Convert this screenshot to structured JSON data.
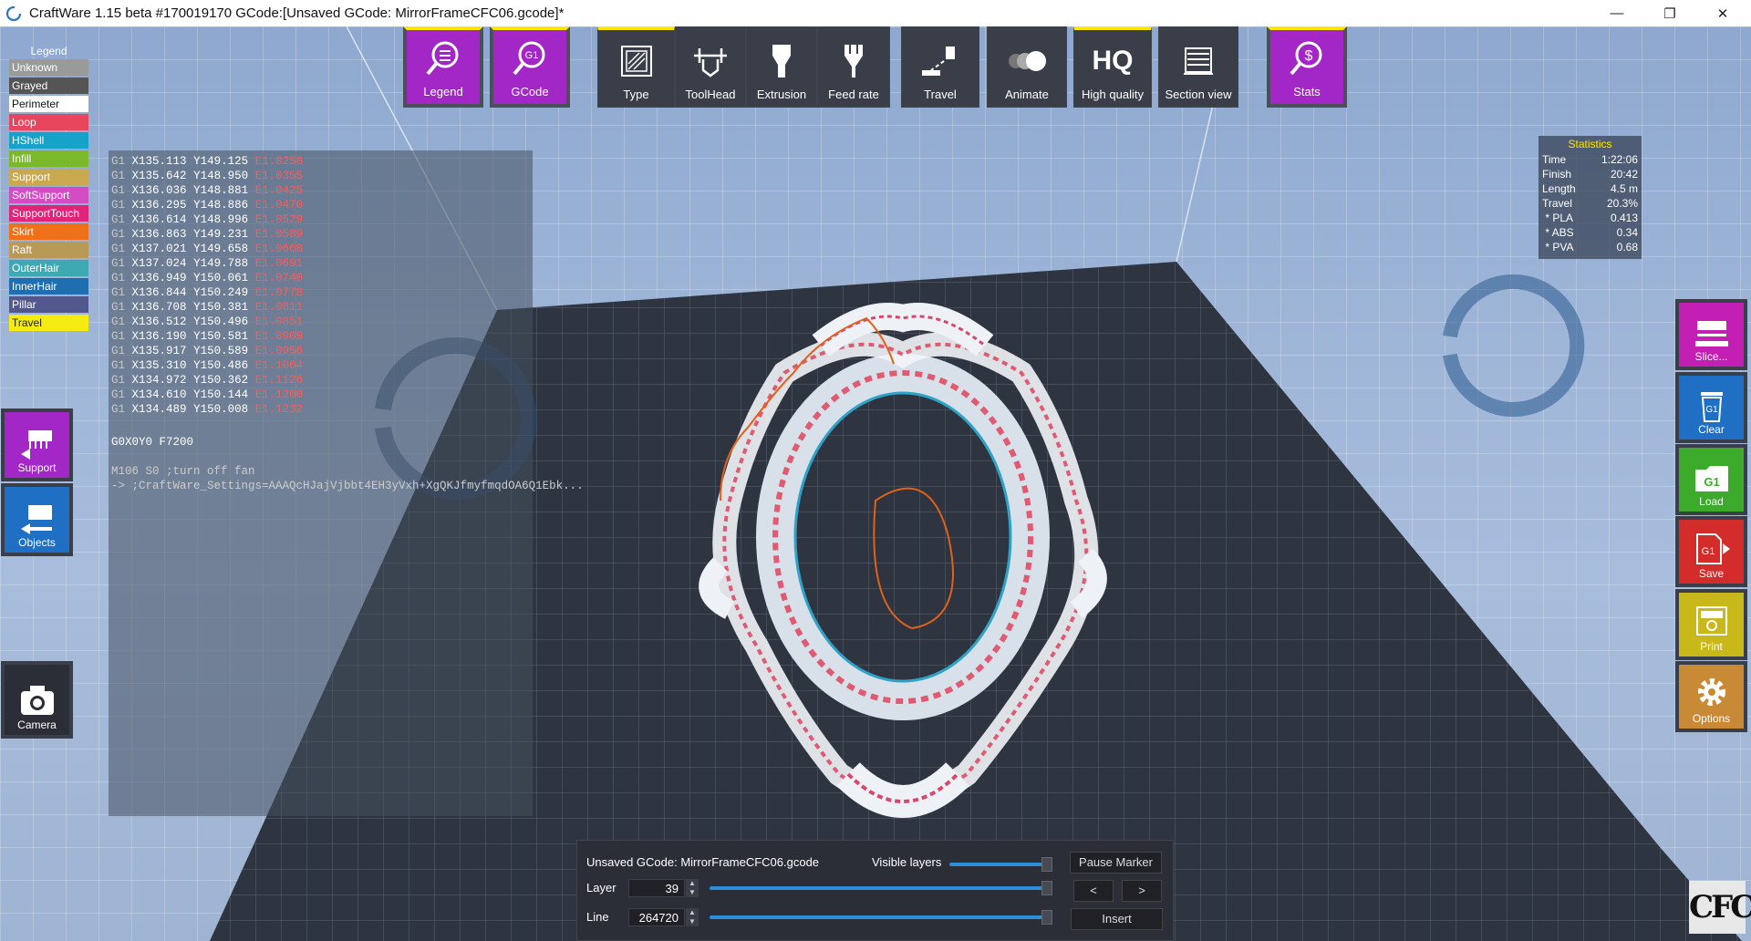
{
  "window": {
    "title": "CraftWare 1.15 beta #170019170   GCode:[Unsaved GCode: MirrorFrameCFC06.gcode]*"
  },
  "legend": {
    "title": "Legend",
    "items": [
      {
        "label": "Unknown",
        "color": "#9a9a9a",
        "text_color": "#ffffff"
      },
      {
        "label": "Grayed",
        "color": "#555555",
        "text_color": "#ffffff"
      },
      {
        "label": "Perimeter",
        "color": "#ffffff",
        "text_color": "#111111"
      },
      {
        "label": "Loop",
        "color": "#e8455e",
        "text_color": "#ffffff"
      },
      {
        "label": "HShell",
        "color": "#17a3c9",
        "text_color": "#ffffff"
      },
      {
        "label": "Infill",
        "color": "#79b92a",
        "text_color": "#ffffff"
      },
      {
        "label": "Support",
        "color": "#c9a84f",
        "text_color": "#ffffff"
      },
      {
        "label": "SoftSupport",
        "color": "#d44cc4",
        "text_color": "#ffffff"
      },
      {
        "label": "SupportTouch",
        "color": "#e0247a",
        "text_color": "#ffffff"
      },
      {
        "label": "Skirt",
        "color": "#f0701a",
        "text_color": "#ffffff"
      },
      {
        "label": "Raft",
        "color": "#b89a56",
        "text_color": "#ffffff"
      },
      {
        "label": "OuterHair",
        "color": "#3fa9b3",
        "text_color": "#ffffff"
      },
      {
        "label": "InnerHair",
        "color": "#1f6fb0",
        "text_color": "#ffffff"
      },
      {
        "label": "Pillar",
        "color": "#52588d",
        "text_color": "#ffffff"
      },
      {
        "label": "Travel",
        "color": "#f5ea12",
        "text_color": "#222222"
      }
    ]
  },
  "toolbar": {
    "legend": "Legend",
    "gcode": "GCode",
    "type": "Type",
    "toolhead": "ToolHead",
    "extrusion": "Extrusion",
    "feedrate": "Feed rate",
    "travel": "Travel",
    "animate": "Animate",
    "high_quality": "High quality",
    "hq_glyph": "HQ",
    "section_view": "Section view",
    "stats": "Stats"
  },
  "gcode_lines": [
    {
      "g": "G1",
      "x": "X135.113",
      "y": "Y149.125",
      "e": "E1.0258"
    },
    {
      "g": "G1",
      "x": "X135.642",
      "y": "Y148.950",
      "e": "E1.0355"
    },
    {
      "g": "G1",
      "x": "X136.036",
      "y": "Y148.881",
      "e": "E1.0425"
    },
    {
      "g": "G1",
      "x": "X136.295",
      "y": "Y148.886",
      "e": "E1.0470"
    },
    {
      "g": "G1",
      "x": "X136.614",
      "y": "Y148.996",
      "e": "E1.0529"
    },
    {
      "g": "G1",
      "x": "X136.863",
      "y": "Y149.231",
      "e": "E1.0589"
    },
    {
      "g": "G1",
      "x": "X137.021",
      "y": "Y149.658",
      "e": "E1.0668"
    },
    {
      "g": "G1",
      "x": "X137.024",
      "y": "Y149.788",
      "e": "E1.0691"
    },
    {
      "g": "G1",
      "x": "X136.949",
      "y": "Y150.061",
      "e": "E1.0740"
    },
    {
      "g": "G1",
      "x": "X136.844",
      "y": "Y150.249",
      "e": "E1.0778"
    },
    {
      "g": "G1",
      "x": "X136.708",
      "y": "Y150.381",
      "e": "E1.0811"
    },
    {
      "g": "G1",
      "x": "X136.512",
      "y": "Y150.496",
      "e": "E1.0851"
    },
    {
      "g": "G1",
      "x": "X136.190",
      "y": "Y150.581",
      "e": "E1.0909"
    },
    {
      "g": "G1",
      "x": "X135.917",
      "y": "Y150.589",
      "e": "E1.0956"
    },
    {
      "g": "G1",
      "x": "X135.310",
      "y": "Y150.486",
      "e": "E1.1064"
    },
    {
      "g": "G1",
      "x": "X134.972",
      "y": "Y150.362",
      "e": "E1.1126"
    },
    {
      "g": "G1",
      "x": "X134.610",
      "y": "Y150.144",
      "e": "E1.1200"
    },
    {
      "g": "G1",
      "x": "X134.489",
      "y": "Y150.008",
      "e": "E1.1232"
    }
  ],
  "gcode_extra": {
    "g0_line": "G0X0Y0 F7200",
    "m_line": "M106 S0 ;turn off fan",
    "settings_line": "-> ;CraftWare_Settings=AAAQcHJajVjbbt4EH3yVxh+XgQKJfmyfmqdOA6Q1Ebk..."
  },
  "stats": {
    "title": "Statistics",
    "rows": [
      {
        "k": "Time",
        "v": "1:22:06"
      },
      {
        "k": "Finish",
        "v": "20:42"
      },
      {
        "k": "Length",
        "v": "4.5 m"
      },
      {
        "k": "Travel",
        "v": "20.3%"
      },
      {
        "k": " * PLA",
        "v": "0.413"
      },
      {
        "k": " * ABS",
        "v": "0.34"
      },
      {
        "k": " * PVA",
        "v": "0.68"
      }
    ]
  },
  "left_buttons": {
    "support": "Support",
    "objects": "Objects",
    "camera": "Camera"
  },
  "right_buttons": {
    "slice": "Slice...",
    "clear": "Clear",
    "load": "Load",
    "save": "Save",
    "print": "Print",
    "options": "Options"
  },
  "bottom_panel": {
    "filename": "Unsaved GCode: MirrorFrameCFC06.gcode",
    "visible_layers_label": "Visible layers",
    "layer_label": "Layer",
    "layer_value": "39",
    "line_label": "Line",
    "line_value": "264720",
    "pause_marker": "Pause Marker",
    "prev": "<",
    "next": ">",
    "insert": "Insert"
  },
  "logo": "CFC",
  "colors": {
    "purple": "#a326c6",
    "accent_yellow": "#ffe600",
    "slider_blue": "#2b8ed6"
  }
}
